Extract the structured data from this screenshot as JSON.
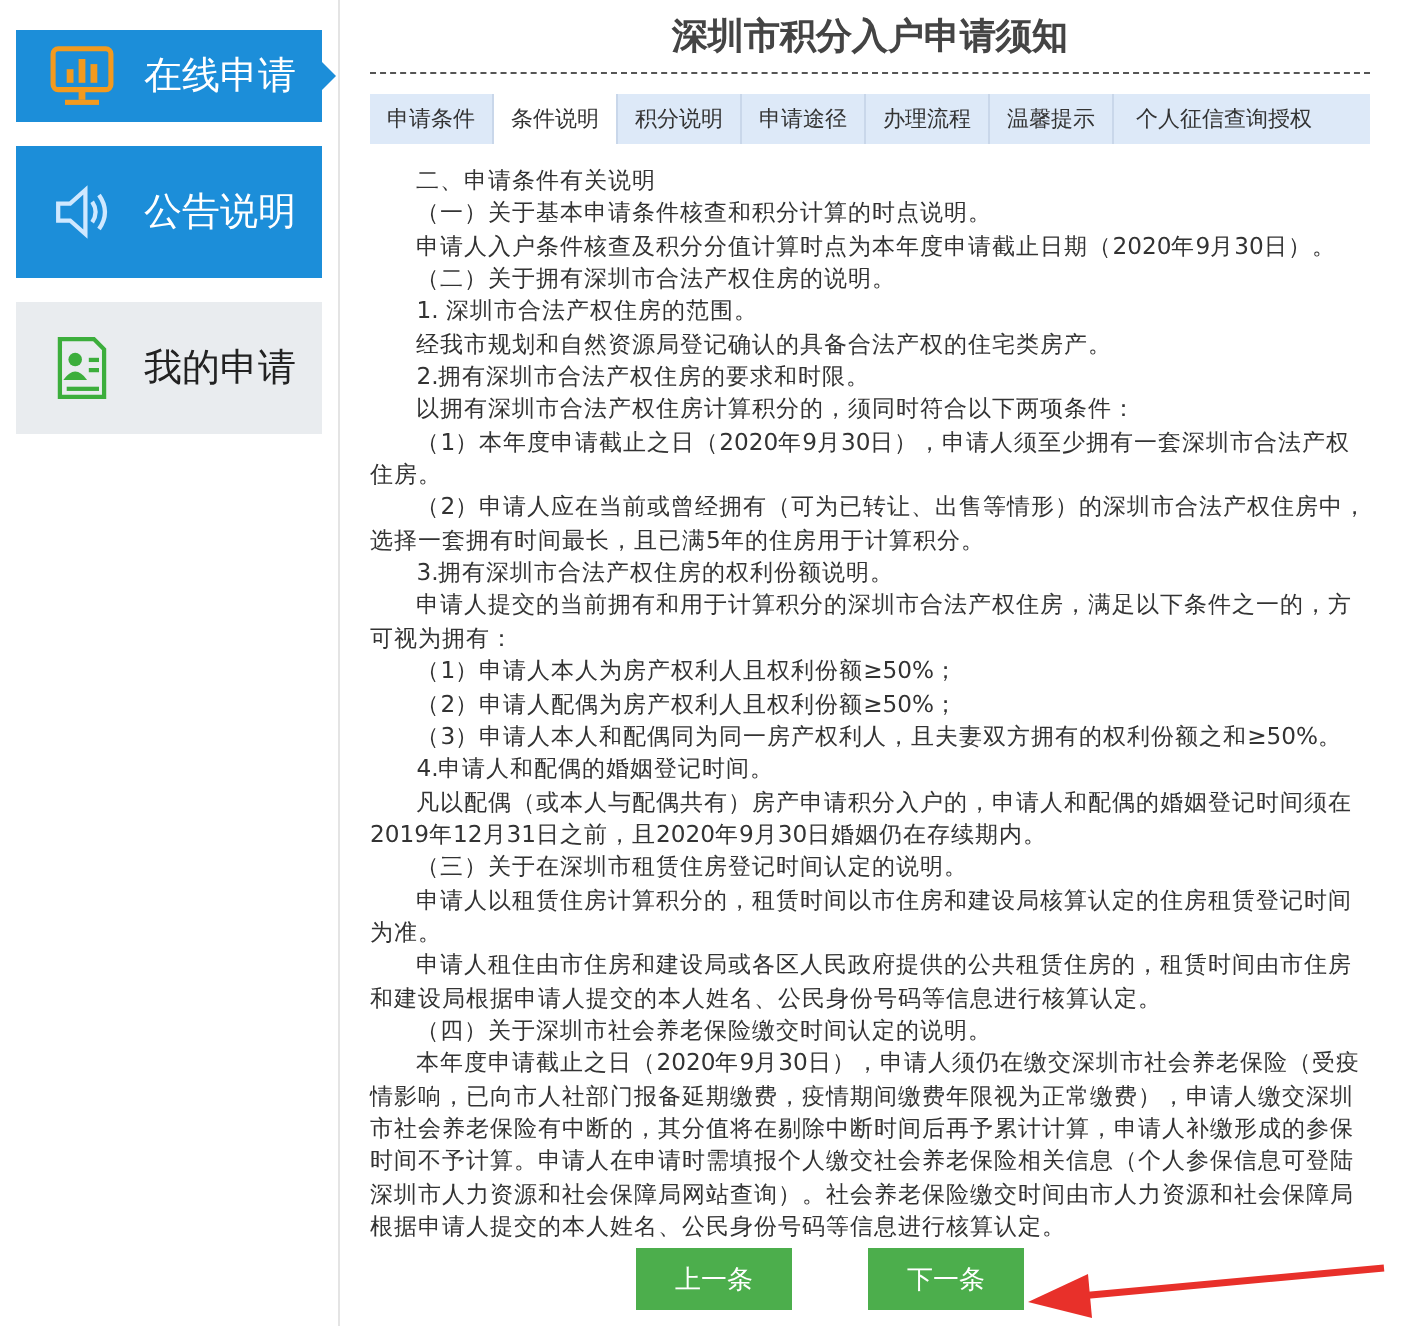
{
  "sidebar": {
    "items": [
      {
        "label": "在线申请",
        "kind": "chart",
        "active": true,
        "pointer": true
      },
      {
        "label": "公告说明",
        "kind": "speaker",
        "active": true,
        "pointer": false
      },
      {
        "label": "我的申请",
        "kind": "profile",
        "active": false,
        "pointer": false
      }
    ]
  },
  "title": "深圳市积分入户申请须知",
  "tabs": [
    {
      "label": "申请条件",
      "selected": false
    },
    {
      "label": "条件说明",
      "selected": true
    },
    {
      "label": "积分说明",
      "selected": false
    },
    {
      "label": "申请途径",
      "selected": false
    },
    {
      "label": "办理流程",
      "selected": false
    },
    {
      "label": "温馨提示",
      "selected": false
    },
    {
      "label": "个人征信查询授权",
      "selected": false
    }
  ],
  "paragraphs": [
    "二、申请条件有关说明",
    "（一）关于基本申请条件核查和积分计算的时点说明。",
    "申请人入户条件核查及积分分值计算时点为本年度申请截止日期（2020年9月30日）。",
    "（二）关于拥有深圳市合法产权住房的说明。",
    "1. 深圳市合法产权住房的范围。",
    "经我市规划和自然资源局登记确认的具备合法产权的住宅类房产。",
    "2.拥有深圳市合法产权住房的要求和时限。",
    "以拥有深圳市合法产权住房计算积分的，须同时符合以下两项条件：",
    "（1）本年度申请截止之日（2020年9月30日），申请人须至少拥有一套深圳市合法产权住房。",
    "（2）申请人应在当前或曾经拥有（可为已转让、出售等情形）的深圳市合法产权住房中，选择一套拥有时间最长，且已满5年的住房用于计算积分。",
    "3.拥有深圳市合法产权住房的权利份额说明。",
    "申请人提交的当前拥有和用于计算积分的深圳市合法产权住房，满足以下条件之一的，方可视为拥有：",
    "（1）申请人本人为房产权利人且权利份额≥50%；",
    "（2）申请人配偶为房产权利人且权利份额≥50%；",
    "（3）申请人本人和配偶同为同一房产权利人，且夫妻双方拥有的权利份额之和≥50%。",
    "4.申请人和配偶的婚姻登记时间。",
    "凡以配偶（或本人与配偶共有）房产申请积分入户的，申请人和配偶的婚姻登记时间须在2019年12月31日之前，且2020年9月30日婚姻仍在存续期内。",
    "（三）关于在深圳市租赁住房登记时间认定的说明。",
    "申请人以租赁住房计算积分的，租赁时间以市住房和建设局核算认定的住房租赁登记时间为准。",
    "申请人租住由市住房和建设局或各区人民政府提供的公共租赁住房的，租赁时间由市住房和建设局根据申请人提交的本人姓名、公民身份号码等信息进行核算认定。",
    "（四）关于深圳市社会养老保险缴交时间认定的说明。",
    "本年度申请截止之日（2020年9月30日），申请人须仍在缴交深圳市社会养老保险（受疫情影响，已向市人社部门报备延期缴费，疫情期间缴费年限视为正常缴费），申请人缴交深圳市社会养老保险有中断的，其分值将在剔除中断时间后再予累计计算，申请人补缴形成的参保时间不予计算。申请人在申请时需填报个人缴交社会养老保险相关信息（个人参保信息可登陆深圳市人力资源和社会保障局网站查询）。社会养老保险缴交时间由市人力资源和社会保障局根据申请人提交的本人姓名、公民身份号码等信息进行核算认定。"
  ],
  "buttons": [
    "上一条",
    "下一条"
  ]
}
